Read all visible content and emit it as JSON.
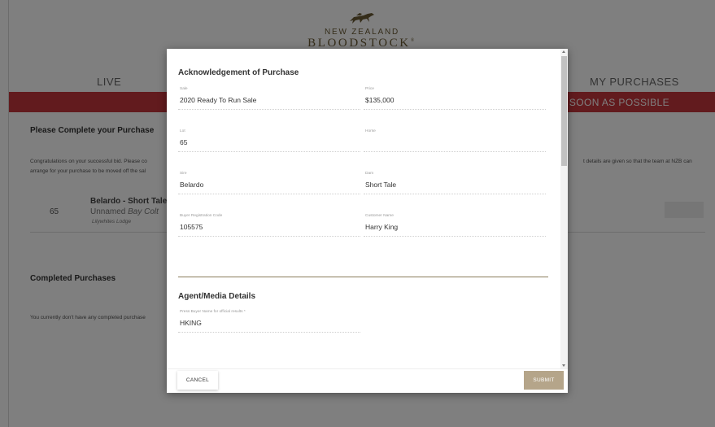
{
  "brand": {
    "line1": "NEW ZEALAND",
    "line2": "BLOODSTOCK",
    "mark": "®"
  },
  "nav": {
    "live": "LIVE",
    "my_purchases": "MY PURCHASES"
  },
  "banner": {
    "text": "AS SOON AS POSSIBLE"
  },
  "page": {
    "please_complete_title": "Please Complete your Purchase",
    "congrats_left_1": "Congratulations on your successful bid. Please co",
    "congrats_left_2": "arrange for your purchase to be moved off the sal",
    "congrats_right": "t details are given so that the team at NZB can",
    "lot": {
      "number": "65",
      "name": "Belardo - Short Tale",
      "desc_plain": "Unnamed ",
      "desc_italic": "Bay Colt",
      "vendor": "Lilywhites Lodge"
    },
    "completed_title": "Completed Purchases",
    "completed_text": "You currently don't have any completed purchase"
  },
  "modal": {
    "ack_title": "Acknowledgement of Purchase",
    "fields": [
      {
        "label": "Sale",
        "value": "2020 Ready To Run Sale"
      },
      {
        "label": "Price",
        "value": "$135,000"
      },
      {
        "label": "Lot",
        "value": "65"
      },
      {
        "label": "Horse",
        "value": ""
      },
      {
        "label": "Sire",
        "value": "Belardo"
      },
      {
        "label": "Dam",
        "value": "Short Tale"
      },
      {
        "label": "Buyer Registration Code",
        "value": "105575"
      },
      {
        "label": "Customer Name",
        "value": "Harry King"
      }
    ],
    "agent_title": "Agent/Media Details",
    "press_buyer": {
      "label": "Press Buyer Name for official results *",
      "value": "HKING"
    },
    "cancel_label": "CANCEL",
    "submit_label": "SUBMIT"
  },
  "colors": {
    "banner": "#c4373d",
    "brand": "#6a5a35",
    "submit": "#b5a58a",
    "divider": "#8a7c5a"
  },
  "icons": {
    "logo": "galloping-horse-icon",
    "scroll_up": "chevron-up-icon",
    "scroll_down": "chevron-down-icon"
  }
}
